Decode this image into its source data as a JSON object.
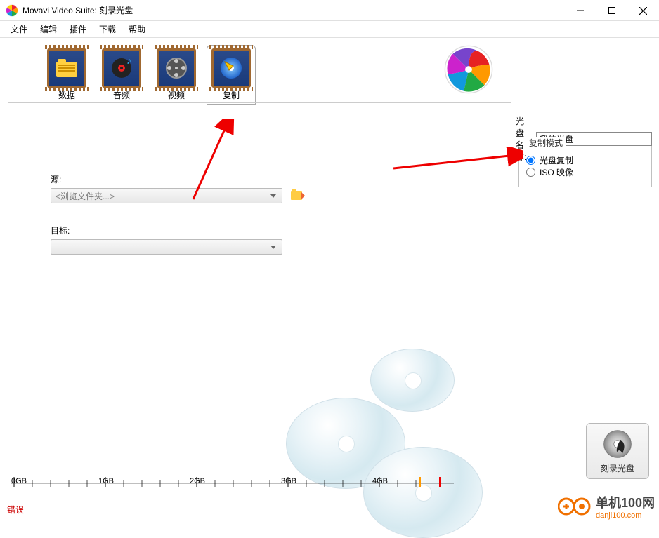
{
  "window": {
    "title": "Movavi Video Suite: 刻录光盘"
  },
  "menu": {
    "file": "文件",
    "edit": "编辑",
    "plugin": "插件",
    "download": "下载",
    "help": "帮助"
  },
  "tabs": {
    "data": "数据",
    "audio": "音频",
    "video": "视频",
    "copy": "复制"
  },
  "form": {
    "source_label": "源:",
    "source_placeholder": "<浏览文件夹...>",
    "target_label": "目标:"
  },
  "sidebar": {
    "disc_name_label": "光盘名称:",
    "disc_name_value": "我的光盘",
    "fieldset_title": "复制模式",
    "opt_disc_copy": "光盘复制",
    "opt_iso": "ISO 映像"
  },
  "burn": {
    "label": "刻录光盘"
  },
  "ruler": {
    "ticks": [
      "0GB",
      "1GB",
      "2GB",
      "3GB",
      "4GB"
    ]
  },
  "footer": {
    "error": "错误"
  },
  "watermark": {
    "name": "单机100网",
    "url": "danji100.com"
  }
}
